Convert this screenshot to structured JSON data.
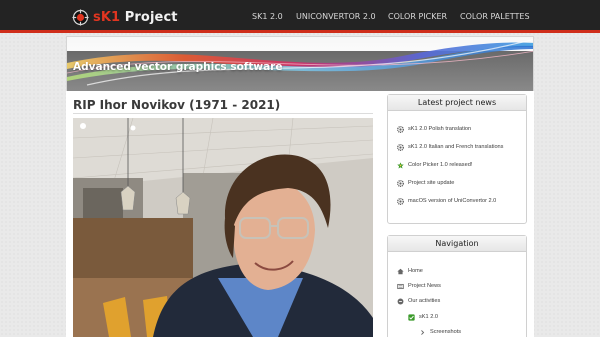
{
  "header": {
    "logo_brand": "sK1",
    "logo_rest": " Project",
    "nav": [
      "SK1 2.0",
      "UNICONVERTOR 2.0",
      "COLOR PICKER",
      "COLOR PALETTES"
    ]
  },
  "banner": {
    "title": "Advanced vector graphics software"
  },
  "post": {
    "title": "RIP Ihor Novikov (1971 - 2021)"
  },
  "news": {
    "heading": "Latest project news",
    "items": [
      {
        "label": "sK1 2.0 Polish translation",
        "icon": "gear-icon"
      },
      {
        "label": "sK1 2.0 Italian and French translations",
        "icon": "gear-icon"
      },
      {
        "label": "Color Picker 1.0 released!",
        "icon": "color-picker-icon"
      },
      {
        "label": "Project site update",
        "icon": "gear-icon"
      },
      {
        "label": "macOS version of UniConvertor 2.0",
        "icon": "gear-icon"
      }
    ]
  },
  "navigation": {
    "heading": "Navigation",
    "items": [
      {
        "label": "Home",
        "icon": "home-icon"
      },
      {
        "label": "Project News",
        "icon": "news-icon"
      },
      {
        "label": "Our activities",
        "icon": "expand-icon"
      },
      {
        "label": "sK1 2.0",
        "icon": "check-icon"
      },
      {
        "label": "Screenshots",
        "icon": "chevron-right-icon"
      }
    ]
  },
  "colors": {
    "accent": "#cf2d1a",
    "header_bg": "#232323",
    "check": "#3a9a2a"
  }
}
